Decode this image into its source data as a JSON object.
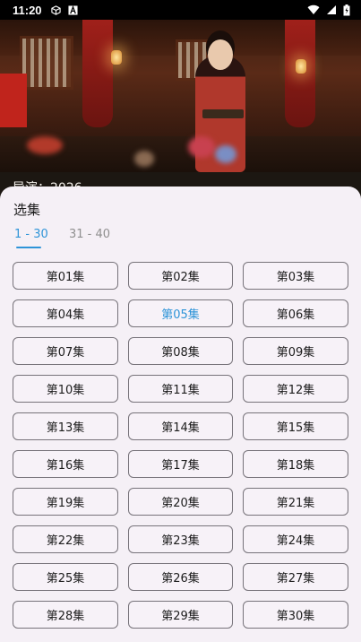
{
  "status_bar": {
    "time": "11:20"
  },
  "video": {
    "title_partial": "导演：2026"
  },
  "episode_sheet": {
    "title": "选集",
    "tabs": [
      {
        "label": "1 - 30",
        "active": true
      },
      {
        "label": "31 - 40",
        "active": false
      }
    ],
    "selected_episode": "第05集",
    "episodes": [
      "第01集",
      "第02集",
      "第03集",
      "第04集",
      "第05集",
      "第06集",
      "第07集",
      "第08集",
      "第09集",
      "第10集",
      "第11集",
      "第12集",
      "第13集",
      "第14集",
      "第15集",
      "第16集",
      "第17集",
      "第18集",
      "第19集",
      "第20集",
      "第21集",
      "第22集",
      "第23集",
      "第24集",
      "第25集",
      "第26集",
      "第27集",
      "第28集",
      "第29集",
      "第30集"
    ]
  },
  "colors": {
    "accent": "#2e94d8",
    "sheet_bg": "#f5f0f6",
    "button_border": "#77737a"
  }
}
